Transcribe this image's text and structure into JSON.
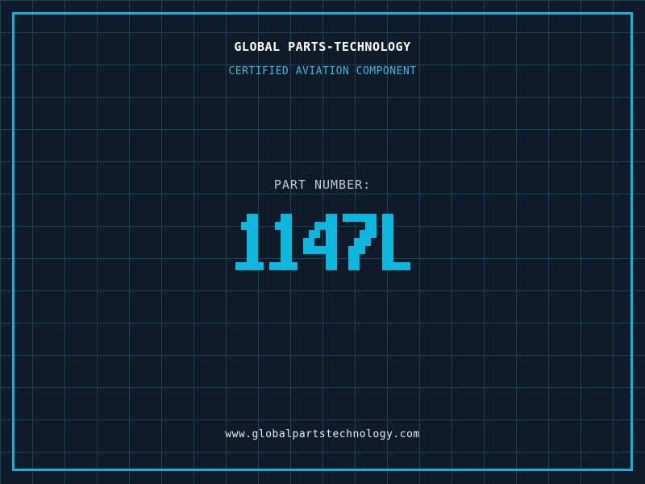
{
  "header": {
    "title": "GLOBAL PARTS-TECHNOLOGY",
    "subtitle": "CERTIFIED AVIATION COMPONENT"
  },
  "part": {
    "label": "PART NUMBER:",
    "number": "1147L"
  },
  "footer": {
    "website": "www.globalpartstechnology.com"
  },
  "colors": {
    "background": "#0f1a2b",
    "grid_line": "#1c4254",
    "frame": "#0db6dc",
    "part_number": "#0db6dc",
    "title": "#ffffff",
    "subtitle": "#3fb8dc",
    "label": "#c0cad0",
    "website": "#e9ecec"
  }
}
